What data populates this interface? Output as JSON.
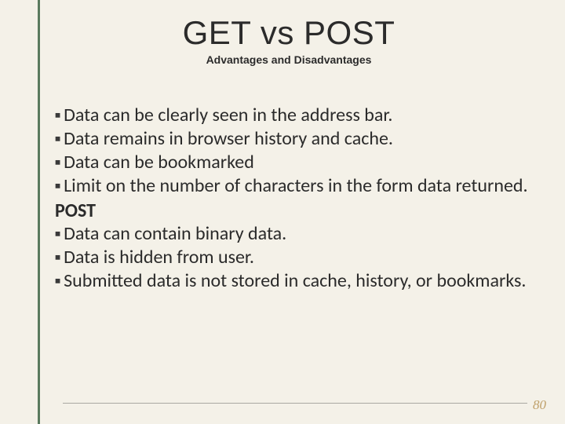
{
  "title": "GET vs POST",
  "subtitle": "Advantages and Disadvantages",
  "bullets_a": [
    "Data can be clearly seen in the address bar.",
    "Data remains in browser history and cache.",
    "Data can be bookmarked",
    "Limit on the number of characters in the form data returned."
  ],
  "section_b_heading": "POST",
  "bullets_b": [
    "Data can contain binary data.",
    "Data is hidden from user.",
    "Submitted data is not stored in cache, history, or bookmarks."
  ],
  "bullet_char": "▪",
  "page_number": "80"
}
